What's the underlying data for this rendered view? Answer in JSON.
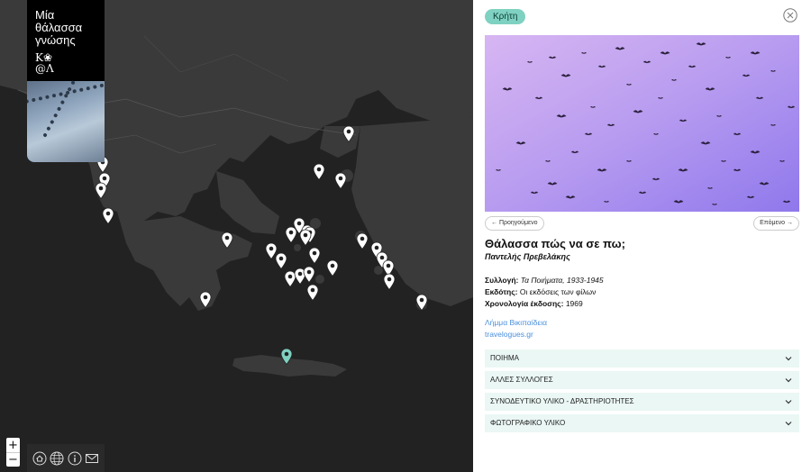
{
  "brand": {
    "title": "Μία θάλασσα γνώσης",
    "logo_line1": "Κ❀",
    "logo_line2": "@Λ"
  },
  "map": {
    "zoom_in": "+",
    "zoom_out": "−",
    "pin_count_default": 33,
    "selected_pin": "Κρήτη",
    "colors": {
      "land": "#3c3c3c",
      "sea": "#222222",
      "pin": "#ffffff",
      "pin_selected": "#7fd1c1"
    }
  },
  "footer_icons": [
    "home-icon",
    "globe-icon",
    "info-icon",
    "mail-icon"
  ],
  "panel": {
    "region": "Κρήτη",
    "prev_label": "← Προηγούμενο",
    "next_label": "Επόμενο →",
    "poem_title": "Θάλασσα πώς να σε πω;",
    "author": "Παντελής Πρεβελάκης",
    "collection_label": "Συλλογή:",
    "collection_value": "Τα Ποιήματα, 1933-1945",
    "publisher_label": "Εκδότης:",
    "publisher_value": "Οι εκδόσεις των φίλων",
    "date_label": "Χρονολογία έκδοσης:",
    "date_value": "1969",
    "links": [
      "Λήμμα Βικιπαίδεια",
      "travelogues.gr"
    ],
    "sections": [
      "ΠΟΙΗΜΑ",
      "ΑΛΛΕΣ ΣΥΛΛΟΓΕΣ",
      "ΣΥΝΟΔΕΥΤΙΚΟ ΥΛΙΚΟ - ΔΡΑΣΤΗΡΙΟΤΗΤΕΣ",
      "ΦΩΤΟΓΡΑΦΙΚΟ ΥΛΙΚΟ"
    ],
    "accent": "#7fd1c1"
  }
}
